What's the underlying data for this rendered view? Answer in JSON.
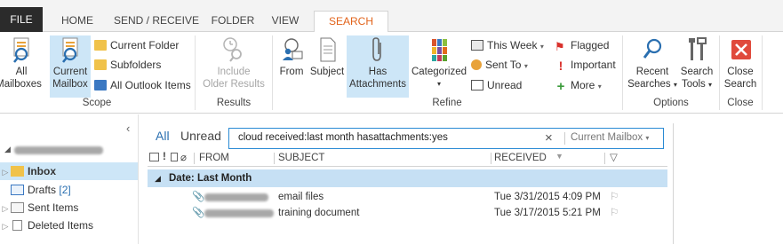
{
  "tabs": [
    {
      "label": "FILE"
    },
    {
      "label": "HOME"
    },
    {
      "label": "SEND / RECEIVE"
    },
    {
      "label": "FOLDER"
    },
    {
      "label": "VIEW"
    },
    {
      "label": "SEARCH"
    }
  ],
  "ribbon": {
    "scope": {
      "label": "Scope",
      "all_mailboxes": [
        "All",
        "Mailboxes"
      ],
      "current_mailbox": [
        "Current",
        "Mailbox"
      ],
      "current_folder": "Current Folder",
      "subfolders": "Subfolders",
      "all_outlook_items": "All Outlook Items"
    },
    "results": {
      "label": "Results",
      "include_older": [
        "Include",
        "Older Results"
      ]
    },
    "refine": {
      "label": "Refine",
      "from": "From",
      "subject": "Subject",
      "has_attachments": [
        "Has",
        "Attachments"
      ],
      "categorized": "Categorized",
      "this_week": "This Week",
      "sent_to": "Sent To",
      "unread": "Unread",
      "flagged": "Flagged",
      "important": "Important",
      "more": "More"
    },
    "options": {
      "label": "Options",
      "recent_searches": [
        "Recent",
        "Searches"
      ],
      "search_tools": [
        "Search",
        "Tools"
      ]
    },
    "close": {
      "label": "Close",
      "close_search": [
        "Close",
        "Search"
      ]
    }
  },
  "nav": {
    "items": [
      {
        "label": "Inbox"
      },
      {
        "label": "Drafts",
        "count": "[2]"
      },
      {
        "label": "Sent Items"
      },
      {
        "label": "Deleted Items"
      }
    ]
  },
  "filters": {
    "all": "All",
    "unread": "Unread"
  },
  "search": {
    "query": "cloud received:last month hasattachments:yes",
    "clear_glyph": "×",
    "scope": "Current Mailbox"
  },
  "columns": {
    "from": "FROM",
    "subject": "SUBJECT",
    "received": "RECEIVED"
  },
  "group": {
    "label": "Date: Last Month"
  },
  "messages": [
    {
      "subject": "email files",
      "received": "Tue 3/31/2015 4:09 PM"
    },
    {
      "subject": "training document",
      "received": "Tue 3/17/2015 5:21 PM"
    }
  ],
  "colors": {
    "accent": "#e2631b",
    "selection": "#cde6f7",
    "search_border": "#2a8ad4",
    "group_row": "#c6e0f4",
    "close_red": "#e04a3c"
  }
}
